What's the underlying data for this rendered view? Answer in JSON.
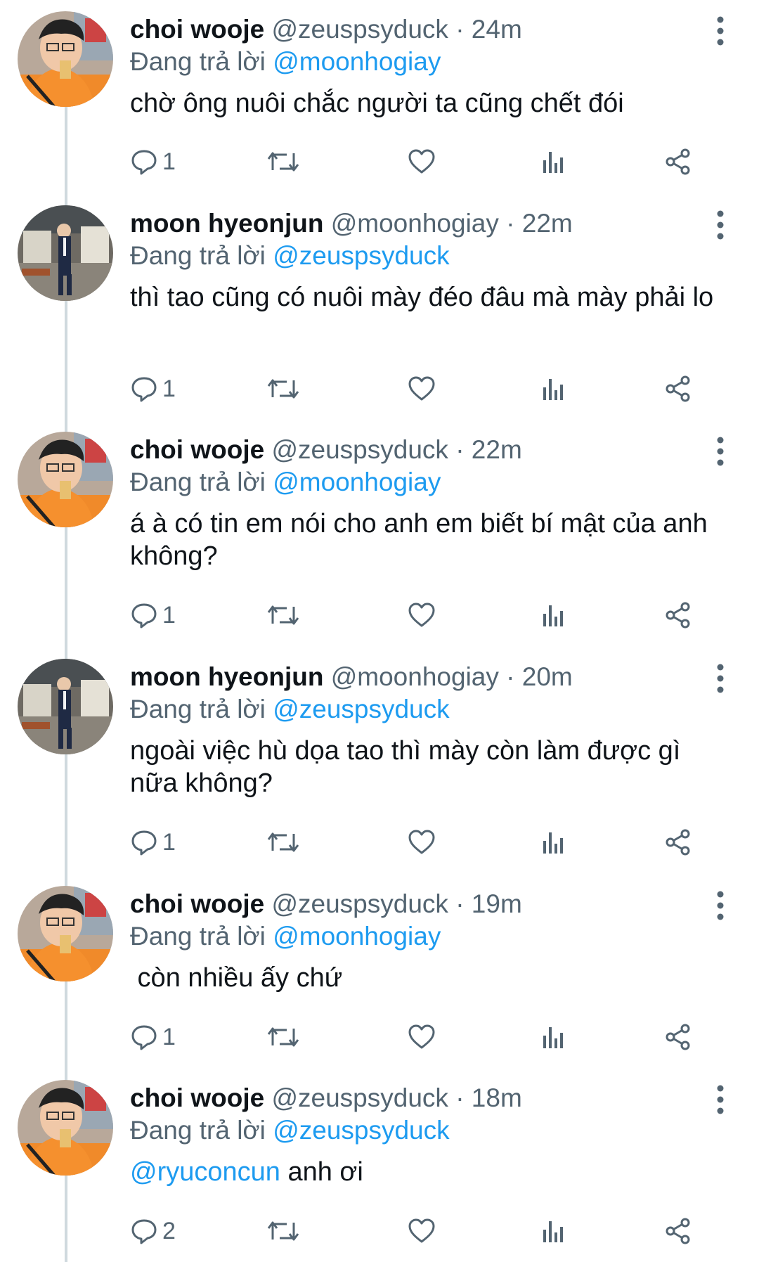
{
  "tweets": [
    {
      "author": "choi wooje",
      "handle": "@zeuspsyduck",
      "time": "· 24m",
      "reply_prefix": "Đang trả lời",
      "reply_to": "@moonhogiay",
      "text_mention": "",
      "text": "chờ ông nuôi chắc người ta cũng chết đói",
      "reply_count": "1",
      "avatar": "orange-hoodie"
    },
    {
      "author": "moon hyeonjun",
      "handle": "@moonhogiay",
      "time": "· 22m",
      "reply_prefix": "Đang trả lời",
      "reply_to": "@zeuspsyduck",
      "text_mention": "",
      "text": "thì tao cũng có nuôi mày đéo đâu mà mày phải lo",
      "reply_count": "1",
      "avatar": "navy-suit"
    },
    {
      "author": "choi wooje",
      "handle": "@zeuspsyduck",
      "time": "· 22m",
      "reply_prefix": "Đang trả lời",
      "reply_to": "@moonhogiay",
      "text_mention": "",
      "text": "á à có tin em nói cho anh em biết bí mật của anh không?",
      "reply_count": "1",
      "avatar": "orange-hoodie"
    },
    {
      "author": "moon hyeonjun",
      "handle": "@moonhogiay",
      "time": "· 20m",
      "reply_prefix": "Đang trả lời",
      "reply_to": "@zeuspsyduck",
      "text_mention": "",
      "text": "ngoài việc hù dọa tao thì mày còn làm được gì nữa không?",
      "reply_count": "1",
      "avatar": "navy-suit"
    },
    {
      "author": "choi wooje",
      "handle": "@zeuspsyduck",
      "time": "· 19m",
      "reply_prefix": "Đang trả lời",
      "reply_to": "@moonhogiay",
      "text_mention": "",
      "text": " còn nhiều ấy chứ",
      "reply_count": "1",
      "avatar": "orange-hoodie"
    },
    {
      "author": "choi wooje",
      "handle": "@zeuspsyduck",
      "time": "· 18m",
      "reply_prefix": "Đang trả lời",
      "reply_to": "@zeuspsyduck",
      "text_mention": "@ryuconcun",
      "text": " anh ơi",
      "reply_count": "2",
      "avatar": "orange-hoodie"
    }
  ],
  "colors": {
    "name": "#0f1419",
    "meta": "#536471",
    "mention": "#1d9bf0",
    "thread_line": "#cfd9de",
    "icon": "#536471"
  },
  "icons": [
    "more-vertical-icon",
    "reply-icon",
    "retweet-icon",
    "like-icon",
    "views-icon",
    "share-icon"
  ]
}
